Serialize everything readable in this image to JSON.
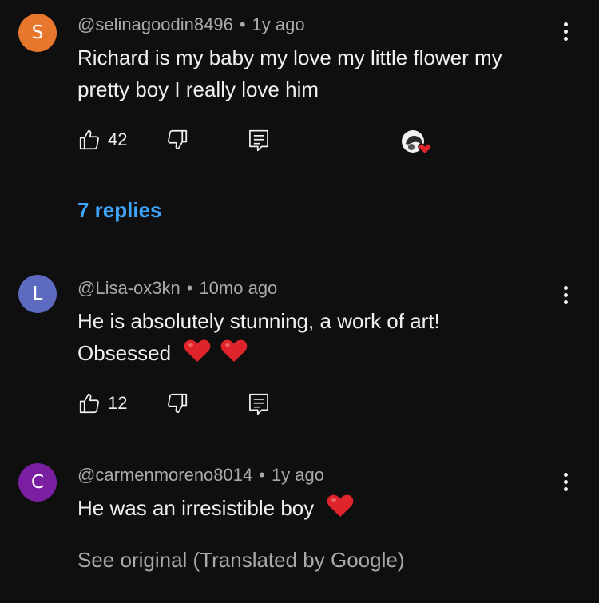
{
  "comments": [
    {
      "avatar_letter": "S",
      "avatar_color": "#e8772e",
      "handle": "@selinagoodin8496",
      "time": "1y ago",
      "text_line1": "Richard is my baby my love my little flower my",
      "text_line2": "pretty boy I really love him",
      "likes": "42",
      "replies": "7 replies",
      "has_creator_heart": true
    },
    {
      "avatar_letter": "L",
      "avatar_color": "#5c6bc0",
      "handle": "@Lisa-ox3kn",
      "time": "10mo ago",
      "text_line1": "He is absolutely stunning, a work of art!",
      "text_line2": "Obsessed",
      "likes": "12"
    },
    {
      "avatar_letter": "C",
      "avatar_color": "#7b1fa2",
      "handle": "@carmenmoreno8014",
      "time": "1y ago",
      "text_line1": "He was an irresistible boy",
      "translated_note": "See original (Translated by Google)"
    }
  ],
  "colors": {
    "background": "#0f0f0f",
    "reply_link": "#3ea6ff",
    "heart": "#e0242b"
  },
  "icons": [
    "thumbs-up-icon",
    "thumbs-down-icon",
    "reply-icon",
    "more-vert-icon",
    "heart-emoji-icon",
    "creator-heart-icon"
  ]
}
